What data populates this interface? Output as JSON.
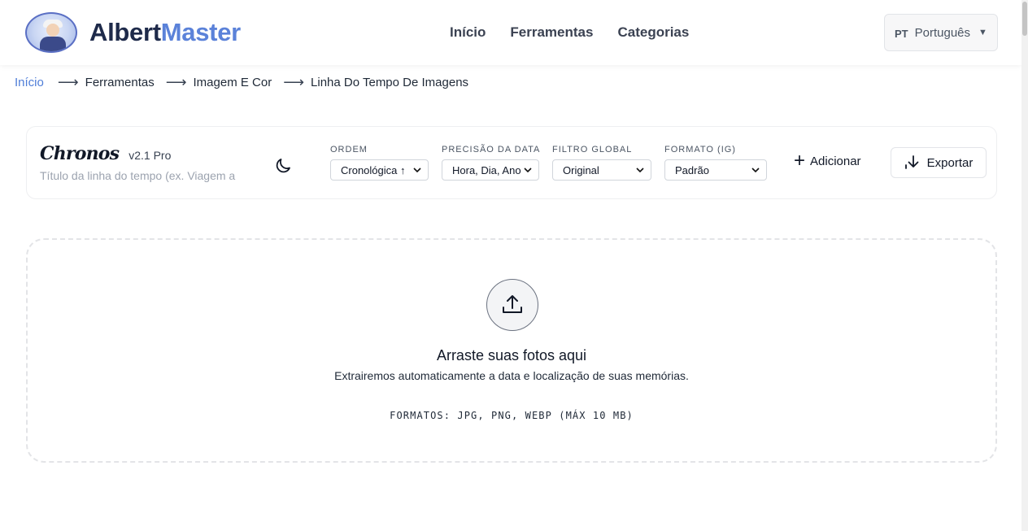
{
  "header": {
    "brand_part1": "Albert",
    "brand_part2": "Master",
    "logo_icon": "albert-avatar-logo",
    "nav": [
      "Início",
      "Ferramentas",
      "Categorias"
    ],
    "language": {
      "code": "PT",
      "name": "Português",
      "caret": "▼"
    }
  },
  "breadcrumb": {
    "items": [
      "Início",
      "Ferramentas",
      "Imagem E Cor",
      "Linha Do Tempo De Imagens"
    ],
    "separator": "⟶"
  },
  "toolbar": {
    "app_name": "Chronos",
    "version": "v2.1 Pro",
    "title_placeholder": "Título da linha do tempo (ex. Viagem a",
    "theme_icon": "moon-icon",
    "fields": [
      {
        "label": "ORDEM",
        "value": "Cronológica ↑"
      },
      {
        "label": "PRECISÃO DA DATA",
        "value": "Hora, Dia, Ano"
      },
      {
        "label": "FILTRO GLOBAL",
        "value": "Original"
      },
      {
        "label": "FORMATO (IG)",
        "value": "Padrão"
      }
    ],
    "add_label": "Adicionar",
    "export_label": "Exportar"
  },
  "dropzone": {
    "icon": "upload-icon",
    "title": "Arraste suas fotos aqui",
    "subtitle": "Extrairemos automaticamente a data e localização de suas memórias.",
    "formats": "FORMATOS: JPG, PNG, WEBP (MÁX 10 MB)"
  },
  "colors": {
    "brand_dark": "#1e2a4a",
    "brand_accent": "#5b82d9",
    "link": "#4f7ed8"
  }
}
